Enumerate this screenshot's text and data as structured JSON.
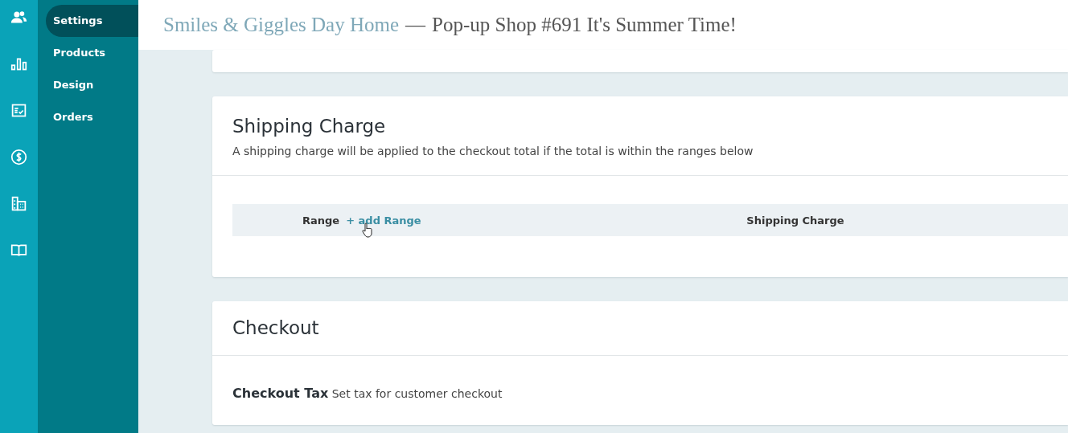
{
  "nav": {
    "items": [
      {
        "label": "Settings",
        "selected": true
      },
      {
        "label": "Products",
        "selected": false
      },
      {
        "label": "Design",
        "selected": false
      },
      {
        "label": "Orders",
        "selected": false
      }
    ]
  },
  "header": {
    "org": "Smiles & Giggles Day Home",
    "separator": "—",
    "shop": "Pop-up Shop #691 It's Summer Time!"
  },
  "shipping": {
    "title": "Shipping Charge",
    "description": "A shipping charge will be applied to the checkout total if the total is within the ranges below",
    "columns": [
      {
        "label": "Range",
        "link": "+ add Range"
      },
      {
        "label": "Shipping Charge"
      }
    ]
  },
  "checkout": {
    "title": "Checkout",
    "rows": [
      {
        "label": "Checkout Tax",
        "description": "Set tax for customer checkout"
      }
    ]
  }
}
